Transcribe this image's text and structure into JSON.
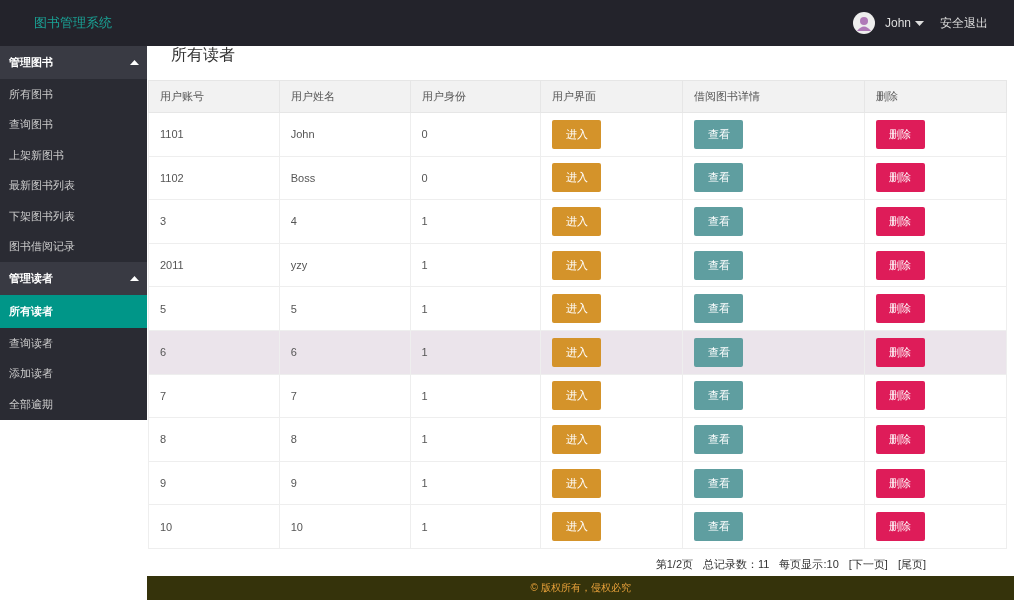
{
  "header": {
    "title": "图书管理系统",
    "user": "John",
    "logout": "安全退出"
  },
  "sidebar": {
    "groups": [
      {
        "label": "管理图书",
        "expanded": true,
        "items": [
          {
            "label": "所有图书",
            "selected": false
          },
          {
            "label": "查询图书",
            "selected": false
          },
          {
            "label": "上架新图书",
            "selected": false
          },
          {
            "label": "最新图书列表",
            "selected": false
          },
          {
            "label": "下架图书列表",
            "selected": false
          },
          {
            "label": "图书借阅记录",
            "selected": false
          }
        ]
      },
      {
        "label": "管理读者",
        "expanded": true,
        "items": [
          {
            "label": "所有读者",
            "selected": true
          },
          {
            "label": "查询读者",
            "selected": false
          },
          {
            "label": "添加读者",
            "selected": false
          },
          {
            "label": "全部逾期",
            "selected": false
          }
        ]
      }
    ]
  },
  "page_title": "所有读者",
  "table": {
    "columns": [
      "用户账号",
      "用户姓名",
      "用户身份",
      "用户界面",
      "借阅图书详情",
      "删除"
    ],
    "rows": [
      {
        "account": "1101",
        "name": "John",
        "role": "0",
        "enter": "进入",
        "view": "查看",
        "delete": "删除",
        "selected": false
      },
      {
        "account": "1102",
        "name": "Boss",
        "role": "0",
        "enter": "进入",
        "view": "查看",
        "delete": "删除",
        "selected": false
      },
      {
        "account": "3",
        "name": "4",
        "role": "1",
        "enter": "进入",
        "view": "查看",
        "delete": "删除",
        "selected": false
      },
      {
        "account": "2011",
        "name": "yzy",
        "role": "1",
        "enter": "进入",
        "view": "查看",
        "delete": "删除",
        "selected": false
      },
      {
        "account": "5",
        "name": "5",
        "role": "1",
        "enter": "进入",
        "view": "查看",
        "delete": "删除",
        "selected": false
      },
      {
        "account": "6",
        "name": "6",
        "role": "1",
        "enter": "进入",
        "view": "查看",
        "delete": "删除",
        "selected": true
      },
      {
        "account": "7",
        "name": "7",
        "role": "1",
        "enter": "进入",
        "view": "查看",
        "delete": "删除",
        "selected": false
      },
      {
        "account": "8",
        "name": "8",
        "role": "1",
        "enter": "进入",
        "view": "查看",
        "delete": "删除",
        "selected": false
      },
      {
        "account": "9",
        "name": "9",
        "role": "1",
        "enter": "进入",
        "view": "查看",
        "delete": "删除",
        "selected": false
      },
      {
        "account": "10",
        "name": "10",
        "role": "1",
        "enter": "进入",
        "view": "查看",
        "delete": "删除",
        "selected": false
      }
    ]
  },
  "pagination": {
    "page": "第1/2页",
    "total": "总记录数：11",
    "per_page": "每页显示:10",
    "next": "[下一页]",
    "last": "[尾页]"
  },
  "footer": "© 版权所有，侵权必究"
}
